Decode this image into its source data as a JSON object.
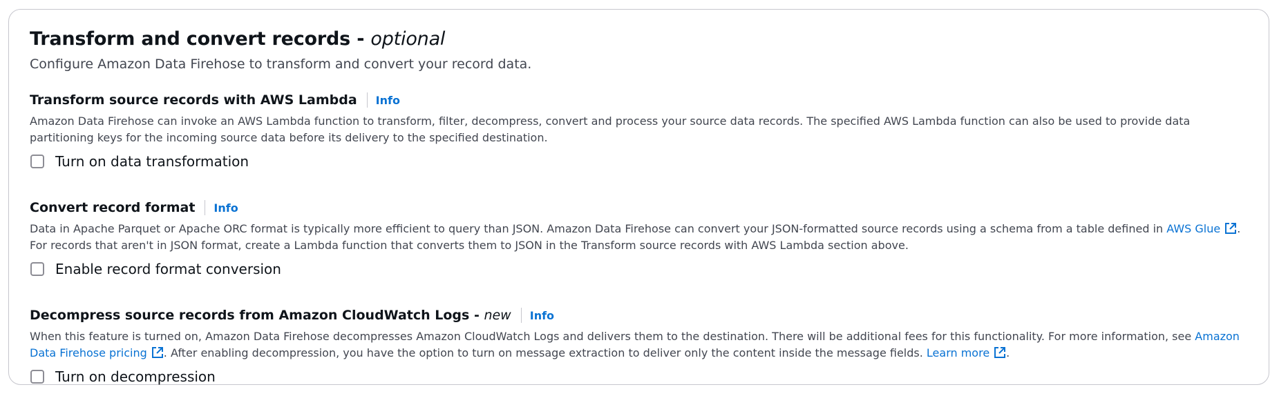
{
  "panel": {
    "title": "Transform and convert records - ",
    "title_optional": "optional",
    "subtitle": "Configure Amazon Data Firehose to transform and convert your record data."
  },
  "sections": [
    {
      "title": "Transform source records with AWS Lambda",
      "info": "Info",
      "description": "Amazon Data Firehose can invoke an AWS Lambda function to transform, filter, decompress, convert and process your source data records. The specified AWS Lambda function can also be used to provide data partitioning keys for the incoming source data before its delivery to the specified destination.",
      "checkbox_label": "Turn on data transformation",
      "checked": false
    },
    {
      "title": "Convert record format",
      "info": "Info",
      "description_before": "Data in Apache Parquet or Apache ORC format is typically more efficient to query than JSON. Amazon Data Firehose can convert your JSON-formatted source records using a schema from a table defined in ",
      "link_text": "AWS Glue",
      "description_after": ". For records that aren't in JSON format, create a Lambda function that converts them to JSON in the Transform source records with AWS Lambda section above.",
      "checkbox_label": "Enable record format conversion",
      "checked": false
    },
    {
      "title": "Decompress source records from Amazon CloudWatch Logs - ",
      "title_new": "new",
      "info": "Info",
      "description_before": "When this feature is turned on, Amazon Data Firehose decompresses Amazon CloudWatch Logs and delivers them to the destination. There will be additional fees for this functionality. For more information, see ",
      "link_text": "Amazon Data Firehose pricing",
      "description_middle": ". After enabling decompression, you have the option to turn on message extraction to deliver only the content inside the message fields. ",
      "link2_text": "Learn more",
      "description_after": ".",
      "checkbox_label": "Turn on decompression",
      "checked": false
    }
  ],
  "colors": {
    "link": "#0972d3",
    "text": "#0f141a",
    "secondary_text": "#424650",
    "border": "#c6c6cd"
  },
  "icons": {
    "external_link": "external-link-icon"
  }
}
